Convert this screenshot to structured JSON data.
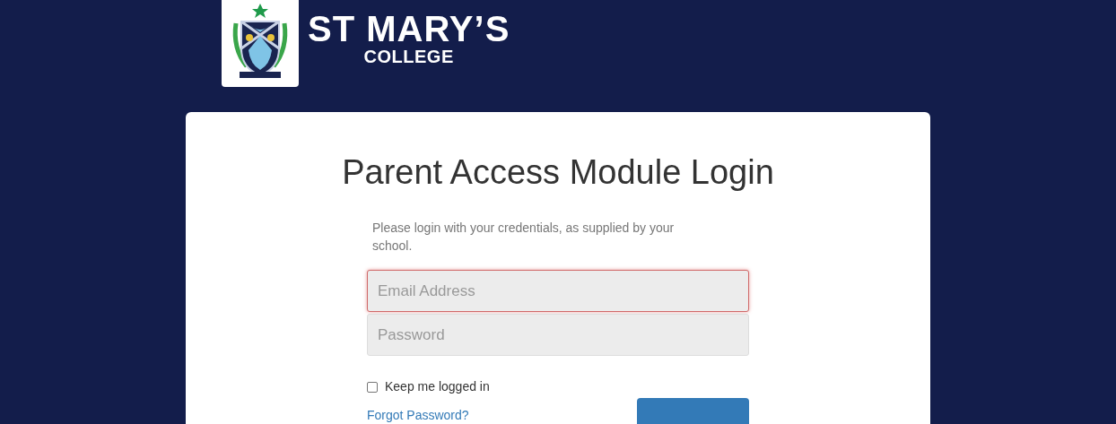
{
  "logo": {
    "line_1": "ST MARY’S",
    "line_2": "COLLEGE"
  },
  "login": {
    "title": "Parent Access Module Login",
    "intro": "Please login with your credentials, as supplied by your school.",
    "fields": [
      {
        "placeholder": "Email Address",
        "focused": true
      },
      {
        "placeholder": "Password",
        "focused": false
      }
    ],
    "remember": {
      "label": "Keep me logged in",
      "checked": false
    },
    "forgot_link": "Forgot Password?"
  }
}
